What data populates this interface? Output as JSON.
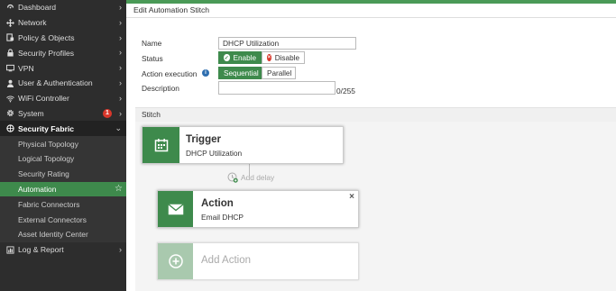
{
  "sidebar": {
    "items": [
      {
        "label": "Dashboard",
        "icon": "dashboard-icon"
      },
      {
        "label": "Network",
        "icon": "network-icon"
      },
      {
        "label": "Policy & Objects",
        "icon": "policy-icon"
      },
      {
        "label": "Security Profiles",
        "icon": "lock-icon"
      },
      {
        "label": "VPN",
        "icon": "vpn-icon"
      },
      {
        "label": "User & Authentication",
        "icon": "user-icon"
      },
      {
        "label": "WiFi Controller",
        "icon": "wifi-icon"
      },
      {
        "label": "System",
        "icon": "gear-icon",
        "badge": "1"
      },
      {
        "label": "Security Fabric",
        "icon": "fabric-icon"
      }
    ],
    "sub_items": [
      {
        "label": "Physical Topology"
      },
      {
        "label": "Logical Topology"
      },
      {
        "label": "Security Rating"
      },
      {
        "label": "Automation"
      },
      {
        "label": "Fabric Connectors"
      },
      {
        "label": "External Connectors"
      },
      {
        "label": "Asset Identity Center"
      }
    ],
    "last_item": {
      "label": "Log & Report",
      "icon": "chart-icon"
    }
  },
  "header": {
    "title": "Edit Automation Stitch"
  },
  "form": {
    "name_label": "Name",
    "name_value": "DHCP Utilization",
    "status_label": "Status",
    "enable_label": "Enable",
    "disable_label": "Disable",
    "action_exec_label": "Action execution",
    "sequential_label": "Sequential",
    "parallel_label": "Parallel",
    "description_label": "Description",
    "char_count": "0/255"
  },
  "stitch": {
    "section_label": "Stitch",
    "trigger_title": "Trigger",
    "trigger_sub": "DHCP Utilization",
    "add_delay": "Add delay",
    "action_title": "Action",
    "action_sub": "Email DHCP",
    "add_action": "Add Action"
  },
  "colors": {
    "accent": "#3e8a4c",
    "sidebar_bg": "#2d2d2d",
    "badge": "#d9372b"
  }
}
